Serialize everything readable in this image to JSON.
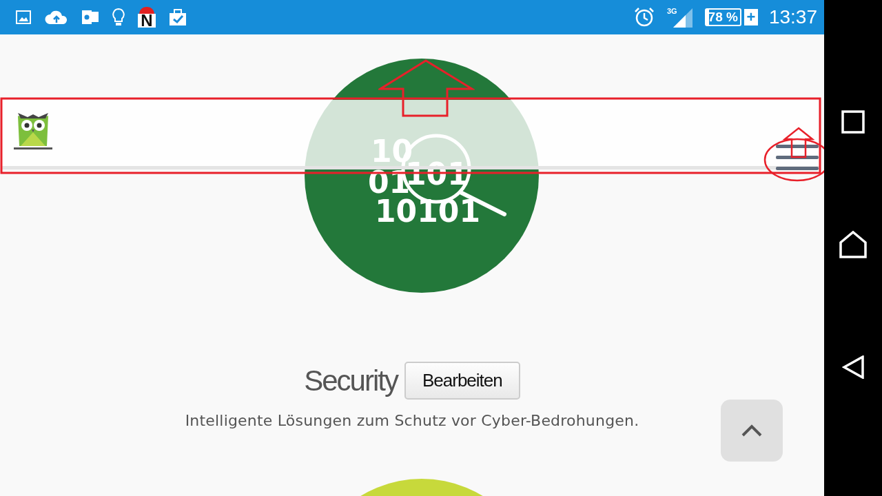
{
  "status_bar": {
    "app_badge": "N",
    "network": "3G",
    "battery": "78 %",
    "charging": "+",
    "time": "13:37"
  },
  "hero": {
    "digits": [
      "10",
      "01",
      "101",
      "10101"
    ]
  },
  "section": {
    "title": "Security",
    "edit_button": "Bearbeiten",
    "description": "Intelligente Lösungen zum Schutz vor Cyber-Bedrohungen."
  }
}
